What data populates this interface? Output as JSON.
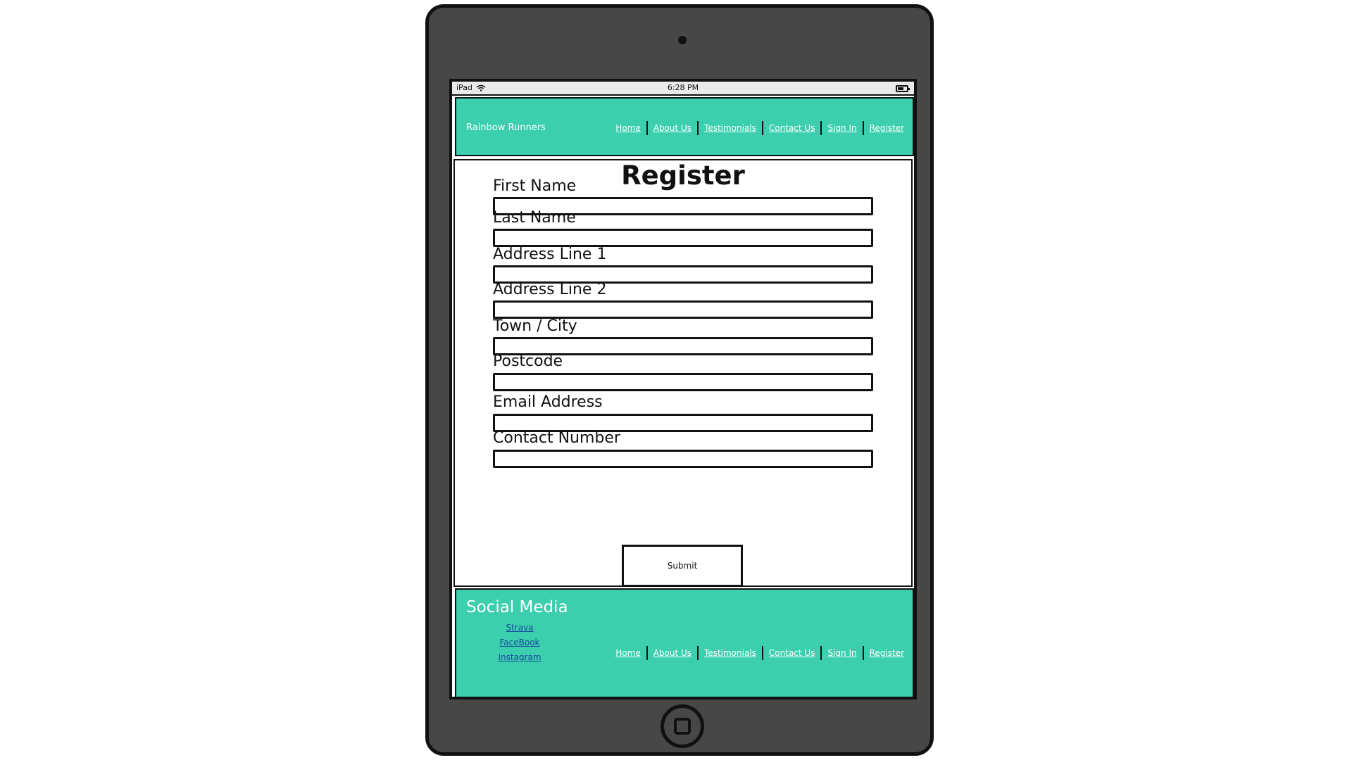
{
  "status_bar": {
    "device": "iPad",
    "time": "6:28 PM"
  },
  "header": {
    "brand": "Rainbow Runners",
    "nav": [
      "Home",
      "About Us",
      "Testimonials",
      "Contact Us",
      "Sign In",
      "Register"
    ]
  },
  "form": {
    "title": "Register",
    "fields": [
      {
        "label": "First Name",
        "value": "",
        "placeholder": ""
      },
      {
        "label": "Last Name",
        "value": "",
        "placeholder": ""
      },
      {
        "label": "Address Line 1",
        "value": "",
        "placeholder": ""
      },
      {
        "label": "Address Line 2",
        "value": "",
        "placeholder": ""
      },
      {
        "label": "Town / City",
        "value": "",
        "placeholder": ""
      },
      {
        "label": "Postcode",
        "value": "",
        "placeholder": ""
      },
      {
        "label": "Email Address",
        "value": "",
        "placeholder": ""
      },
      {
        "label": "Contact Number",
        "value": "",
        "placeholder": ""
      }
    ],
    "submit_label": "Submit"
  },
  "footer": {
    "social_title": "Social Media",
    "social_links": [
      "Strava",
      "FaceBook",
      "Instagram"
    ],
    "nav": [
      "Home",
      "About Us",
      "Testimonials",
      "Contact Us",
      "Sign In",
      "Register"
    ]
  },
  "colors": {
    "accent": "#3bcfae",
    "frame": "#474747",
    "link_dark": "#1a4a9c"
  }
}
